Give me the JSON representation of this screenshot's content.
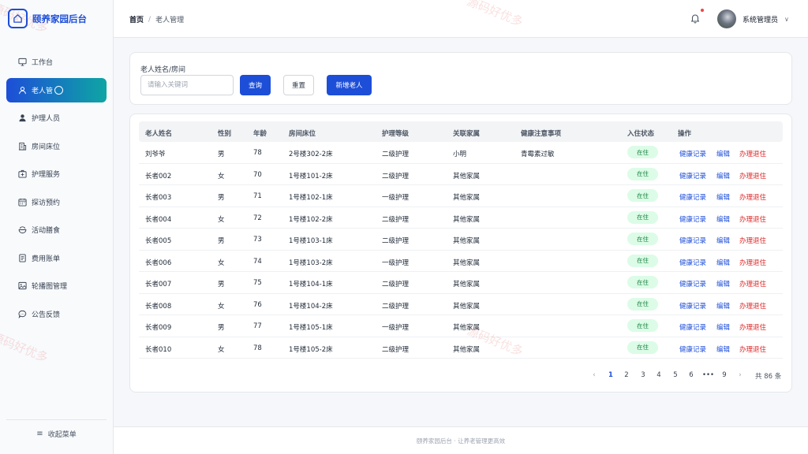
{
  "app": {
    "title": "颐养家园后台"
  },
  "sidebar": {
    "items": [
      {
        "label": "工作台",
        "icon": "monitor-icon",
        "active": false
      },
      {
        "label": "老人管",
        "icon": "user-outline-icon",
        "active": true
      },
      {
        "label": "护理人员",
        "icon": "user-filled-icon",
        "active": false
      },
      {
        "label": "房间床位",
        "icon": "building-icon",
        "active": false
      },
      {
        "label": "护理服务",
        "icon": "medical-kit-icon",
        "active": false
      },
      {
        "label": "探访预约",
        "icon": "calendar-icon",
        "active": false
      },
      {
        "label": "活动膳食",
        "icon": "food-bowl-icon",
        "active": false
      },
      {
        "label": "费用账单",
        "icon": "bill-icon",
        "active": false
      },
      {
        "label": "轮播图管理",
        "icon": "image-icon",
        "active": false
      },
      {
        "label": "公告反馈",
        "icon": "chat-bubble-icon",
        "active": false
      }
    ],
    "collapse_label": "收起菜单"
  },
  "header": {
    "breadcrumb": {
      "home": "首页",
      "separator": "/",
      "current": "老人管理"
    },
    "user_name": "系统管理员",
    "has_notification": true
  },
  "search": {
    "label": "老人姓名/房间",
    "placeholder": "请输入关键词",
    "value": "",
    "query_label": "查询",
    "reset_label": "重置",
    "add_label": "新增老人"
  },
  "table": {
    "columns": [
      "老人姓名",
      "性别",
      "年龄",
      "房间床位",
      "护理等级",
      "关联家属",
      "健康注意事项",
      "入住状态",
      "操作"
    ],
    "action_labels": {
      "health": "健康记录",
      "edit": "编辑",
      "checkout": "办理退住"
    },
    "rows": [
      {
        "name": "刘爷爷",
        "gender": "男",
        "age": "78",
        "room": "2号楼302-2床",
        "level": "二级护理",
        "family": "小明",
        "health": "青霉素过敏",
        "status": "在住"
      },
      {
        "name": "长者002",
        "gender": "女",
        "age": "70",
        "room": "1号楼101-2床",
        "level": "二级护理",
        "family": "其他家属",
        "health": "",
        "status": "在住"
      },
      {
        "name": "长者003",
        "gender": "男",
        "age": "71",
        "room": "1号楼102-1床",
        "level": "一级护理",
        "family": "其他家属",
        "health": "",
        "status": "在住"
      },
      {
        "name": "长者004",
        "gender": "女",
        "age": "72",
        "room": "1号楼102-2床",
        "level": "二级护理",
        "family": "其他家属",
        "health": "",
        "status": "在住"
      },
      {
        "name": "长者005",
        "gender": "男",
        "age": "73",
        "room": "1号楼103-1床",
        "level": "二级护理",
        "family": "其他家属",
        "health": "",
        "status": "在住"
      },
      {
        "name": "长者006",
        "gender": "女",
        "age": "74",
        "room": "1号楼103-2床",
        "level": "一级护理",
        "family": "其他家属",
        "health": "",
        "status": "在住"
      },
      {
        "name": "长者007",
        "gender": "男",
        "age": "75",
        "room": "1号楼104-1床",
        "level": "二级护理",
        "family": "其他家属",
        "health": "",
        "status": "在住"
      },
      {
        "name": "长者008",
        "gender": "女",
        "age": "76",
        "room": "1号楼104-2床",
        "level": "二级护理",
        "family": "其他家属",
        "health": "",
        "status": "在住"
      },
      {
        "name": "长者009",
        "gender": "男",
        "age": "77",
        "room": "1号楼105-1床",
        "level": "一级护理",
        "family": "其他家属",
        "health": "",
        "status": "在住"
      },
      {
        "name": "长者010",
        "gender": "女",
        "age": "78",
        "room": "1号楼105-2床",
        "level": "二级护理",
        "family": "其他家属",
        "health": "",
        "status": "在住"
      }
    ]
  },
  "pagination": {
    "prev": "‹",
    "next": "›",
    "pages": [
      "1",
      "2",
      "3",
      "4",
      "5",
      "6",
      "•••",
      "9"
    ],
    "current_page": "1",
    "total_label": "共 86 条"
  },
  "footer": {
    "text": "颐养家园后台 · 让养老管理更高效"
  },
  "watermark": {
    "text": "源码好优多"
  },
  "colors": {
    "primary": "#1d4ed8",
    "accent": "#0ea5a4",
    "danger": "#dc2626",
    "status_bg": "#dcfce7",
    "status_text": "#15803d"
  }
}
